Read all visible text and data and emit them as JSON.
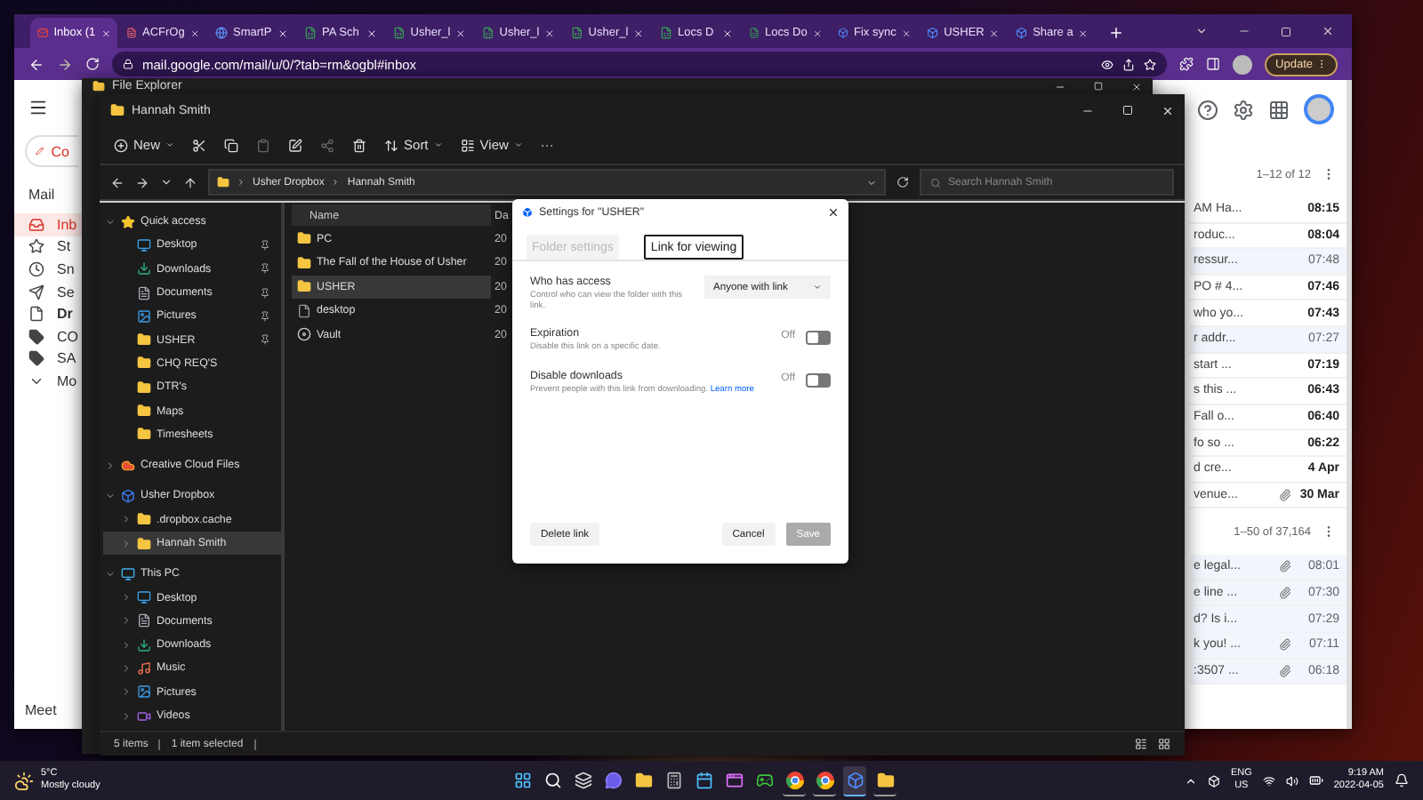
{
  "browser": {
    "tabs": [
      {
        "label": "Inbox (1",
        "kind": "mail",
        "selected": true
      },
      {
        "label": "ACFrOg",
        "kind": "pdf",
        "selected": false
      },
      {
        "label": "SmartP",
        "kind": "web",
        "selected": false
      },
      {
        "label": "PA Sch",
        "kind": "sheet",
        "selected": false
      },
      {
        "label": "Usher_l",
        "kind": "sheet",
        "selected": false
      },
      {
        "label": "Usher_l",
        "kind": "sheet",
        "selected": false
      },
      {
        "label": "Usher_l",
        "kind": "sheet",
        "selected": false
      },
      {
        "label": "Locs D",
        "kind": "sheet",
        "selected": false
      },
      {
        "label": "Locs Do",
        "kind": "sheet",
        "selected": false
      },
      {
        "label": "Fix sync",
        "kind": "box",
        "selected": false
      },
      {
        "label": "USHER",
        "kind": "box",
        "selected": false
      },
      {
        "label": "Share a",
        "kind": "box",
        "selected": false
      }
    ],
    "address": "mail.google.com/mail/u/0/?tab=rm&ogbl#inbox",
    "update_button": "Update"
  },
  "gmail": {
    "compose": "Co",
    "mail_label": "Mail",
    "nav": [
      {
        "label": "Inb",
        "kind": "inbox",
        "selected": true,
        "bold": false
      },
      {
        "label": "St",
        "kind": "star",
        "selected": false,
        "bold": false
      },
      {
        "label": "Sn",
        "kind": "clock",
        "selected": false,
        "bold": false
      },
      {
        "label": "Se",
        "kind": "send",
        "selected": false,
        "bold": false
      },
      {
        "label": "Dr",
        "kind": "file",
        "selected": false,
        "bold": true
      },
      {
        "label": "CO",
        "kind": "label",
        "selected": false,
        "bold": false
      },
      {
        "label": "SA",
        "kind": "label",
        "selected": false,
        "bold": false
      },
      {
        "label": "Mo",
        "kind": "more",
        "selected": false,
        "bold": false
      }
    ],
    "meet": "Meet",
    "lists": [
      {
        "range": "1–12 of 12",
        "rows": [
          {
            "subject": "AM Ha...",
            "time": "08:15",
            "unread": true,
            "attachment": false
          },
          {
            "subject": "roduc...",
            "time": "08:04",
            "unread": true,
            "attachment": false
          },
          {
            "subject": "ressur...",
            "time": "07:48",
            "unread": false,
            "attachment": false
          },
          {
            "subject": "PO # 4...",
            "time": "07:46",
            "unread": true,
            "attachment": false
          },
          {
            "subject": "who yo...",
            "time": "07:43",
            "unread": true,
            "attachment": false
          },
          {
            "subject": "r addr...",
            "time": "07:27",
            "unread": false,
            "attachment": false
          },
          {
            "subject": "start ...",
            "time": "07:19",
            "unread": true,
            "attachment": false
          },
          {
            "subject": "s this ...",
            "time": "06:43",
            "unread": true,
            "attachment": false
          },
          {
            "subject": "Fall o...",
            "time": "06:40",
            "unread": true,
            "attachment": false
          },
          {
            "subject": "fo so ...",
            "time": "06:22",
            "unread": true,
            "attachment": false
          },
          {
            "subject": "d cre...",
            "time": "4 Apr",
            "unread": true,
            "attachment": false
          },
          {
            "subject": "venue...",
            "time": "30 Mar",
            "unread": true,
            "attachment": true
          }
        ]
      },
      {
        "range": "1–50 of 37,164",
        "rows": [
          {
            "subject": "e legal...",
            "time": "08:01",
            "unread": false,
            "attachment": true
          },
          {
            "subject": "e line ...",
            "time": "07:30",
            "unread": false,
            "attachment": true
          },
          {
            "subject": "d? Is i...",
            "time": "07:29",
            "unread": false,
            "attachment": false
          },
          {
            "subject": "k you! ...",
            "time": "07:11",
            "unread": false,
            "attachment": true
          },
          {
            "subject": ":3507 ...",
            "time": "06:18",
            "unread": false,
            "attachment": true
          }
        ]
      }
    ]
  },
  "file_explorer_back": {
    "title": "File Explorer"
  },
  "file_explorer": {
    "title": "Hannah Smith",
    "toolbar": {
      "new": "New",
      "sort": "Sort",
      "view": "View",
      "more": "···"
    },
    "breadcrumb": [
      "Usher Dropbox",
      "Hannah Smith"
    ],
    "search": {
      "placeholder": "Search Hannah Smith"
    },
    "tree": [
      {
        "label": "Quick access",
        "kind": "star",
        "expanded": true,
        "selected": false,
        "children": [
          {
            "label": "Desktop",
            "kind": "desktop",
            "pinned": true,
            "selected": false
          },
          {
            "label": "Downloads",
            "kind": "download",
            "pinned": true,
            "selected": false
          },
          {
            "label": "Documents",
            "kind": "document",
            "pinned": true,
            "selected": false
          },
          {
            "label": "Pictures",
            "kind": "picture",
            "pinned": true,
            "selected": false
          },
          {
            "label": "USHER",
            "kind": "folder",
            "pinned": true,
            "selected": false
          },
          {
            "label": "CHQ REQ'S",
            "kind": "folder",
            "pinned": false,
            "selected": false
          },
          {
            "label": "DTR's",
            "kind": "folder",
            "pinned": false,
            "selected": false
          },
          {
            "label": "Maps",
            "kind": "folder",
            "pinned": false,
            "selected": false
          },
          {
            "label": "Timesheets",
            "kind": "folder",
            "pinned": false,
            "selected": false
          }
        ]
      },
      {
        "label": "Creative Cloud Files",
        "kind": "cloud",
        "expanded": false,
        "selected": false
      },
      {
        "label": "Usher Dropbox",
        "kind": "box",
        "expanded": true,
        "selected": false,
        "children": [
          {
            "label": ".dropbox.cache",
            "kind": "folder",
            "expanded": false,
            "selected": false
          },
          {
            "label": "Hannah Smith",
            "kind": "folder",
            "expanded": false,
            "selected": true
          }
        ]
      },
      {
        "label": "This PC",
        "kind": "pc",
        "expanded": true,
        "selected": false,
        "children": [
          {
            "label": "Desktop",
            "kind": "desktop",
            "expanded": false,
            "selected": false
          },
          {
            "label": "Documents",
            "kind": "document",
            "expanded": false,
            "selected": false
          },
          {
            "label": "Downloads",
            "kind": "download",
            "expanded": false,
            "selected": false
          },
          {
            "label": "Music",
            "kind": "music",
            "expanded": false,
            "selected": false
          },
          {
            "label": "Pictures",
            "kind": "picture",
            "expanded": false,
            "selected": false
          },
          {
            "label": "Videos",
            "kind": "video",
            "expanded": false,
            "selected": false
          }
        ]
      }
    ],
    "columns": [
      "Name",
      "Da"
    ],
    "files": [
      {
        "name": "PC",
        "date": "20",
        "kind": "folder",
        "selected": false
      },
      {
        "name": "The Fall of the House of Usher",
        "date": "20",
        "kind": "folder",
        "selected": false
      },
      {
        "name": "USHER",
        "date": "20",
        "kind": "folder",
        "selected": true
      },
      {
        "name": "desktop",
        "date": "20",
        "kind": "file",
        "selected": false
      },
      {
        "name": "Vault",
        "date": "20",
        "kind": "disc",
        "selected": false
      }
    ],
    "status": [
      "5 items",
      "1 item selected"
    ]
  },
  "dialog": {
    "title": "Settings for \"USHER\"",
    "tabs": [
      {
        "label": "Folder settings",
        "selected": false
      },
      {
        "label": "Link for viewing",
        "selected": true
      }
    ],
    "settings": [
      {
        "kind": "select",
        "title": "Who has access",
        "description": "Control who can view the folder with this link.",
        "value": "Anyone with link"
      },
      {
        "kind": "toggle",
        "title": "Expiration",
        "description": "Disable this link on a specific date.",
        "state_label": "Off",
        "on": false
      },
      {
        "kind": "toggle",
        "title": "Disable downloads",
        "description": "Prevent people with this link from downloading.",
        "link": "Learn more",
        "state_label": "Off",
        "on": false
      }
    ],
    "buttons": [
      {
        "label": "Delete link",
        "kind": "secondary",
        "disabled": false
      },
      {
        "label": "Cancel",
        "kind": "secondary",
        "disabled": false
      },
      {
        "label": "Save",
        "kind": "primary",
        "disabled": true
      }
    ]
  },
  "taskbar": {
    "weather": {
      "temp": "5°C",
      "text": "Mostly cloudy"
    },
    "apps": [
      {
        "kind": "start",
        "running": false,
        "selected": false
      },
      {
        "kind": "search",
        "running": false,
        "selected": false
      },
      {
        "kind": "views",
        "running": false,
        "selected": false
      },
      {
        "kind": "chat",
        "running": false,
        "selected": false
      },
      {
        "kind": "folder",
        "running": false,
        "selected": false
      },
      {
        "kind": "calculator",
        "running": false,
        "selected": false
      },
      {
        "kind": "calendar",
        "running": false,
        "selected": false
      },
      {
        "kind": "app",
        "running": false,
        "selected": false
      },
      {
        "kind": "game",
        "running": false,
        "selected": false
      },
      {
        "kind": "browser",
        "running": true,
        "selected": false
      },
      {
        "kind": "browser",
        "running": true,
        "selected": false
      },
      {
        "kind": "box",
        "running": true,
        "selected": true
      },
      {
        "kind": "folder",
        "running": true,
        "selected": false
      }
    ],
    "language": [
      "ENG",
      "US"
    ],
    "time": "9:19 AM",
    "date": "2022-04-05"
  }
}
